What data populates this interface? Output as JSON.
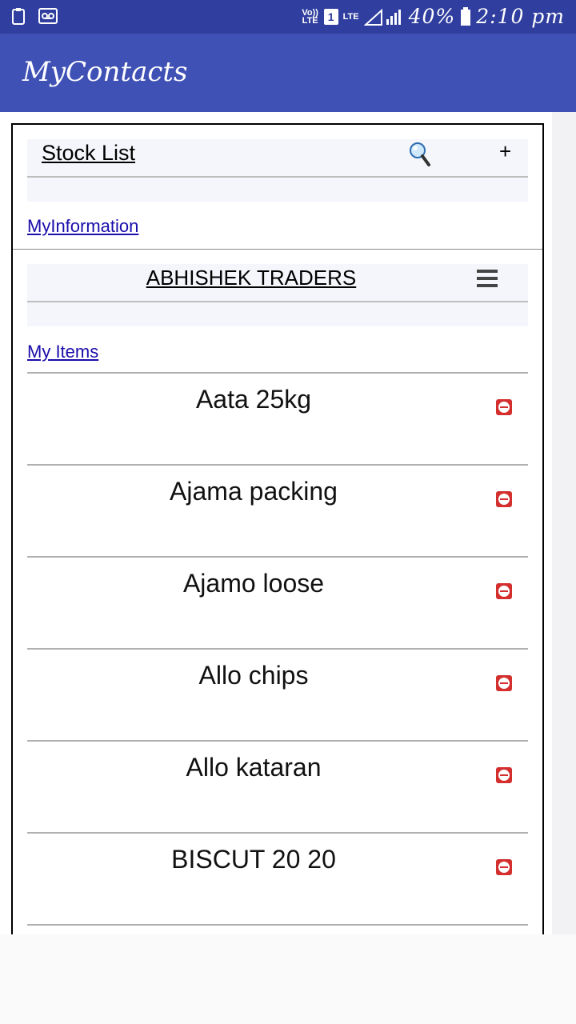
{
  "status_bar": {
    "volte_label": "Vo)) LTE",
    "sim_number": "1",
    "network_label": "LTE",
    "battery_percent": "40%",
    "time": "2:10 pm"
  },
  "app_bar": {
    "title": "MyContacts"
  },
  "stock_header": {
    "title": "Stock List",
    "add_label": "+"
  },
  "my_information_link": "MyInformation",
  "trader_header": {
    "title": "ABHISHEK TRADERS"
  },
  "my_items_link": "My Items",
  "items": [
    {
      "name": "Aata 25kg"
    },
    {
      "name": "Ajama packing"
    },
    {
      "name": "Ajamo loose"
    },
    {
      "name": "Allo chips"
    },
    {
      "name": "Allo kataran"
    },
    {
      "name": "BISCUT 20 20"
    }
  ],
  "colors": {
    "status_bar": "#303f9f",
    "app_bar": "#3f51b5",
    "link": "#1a0dab",
    "delete": "#d32f2f"
  }
}
